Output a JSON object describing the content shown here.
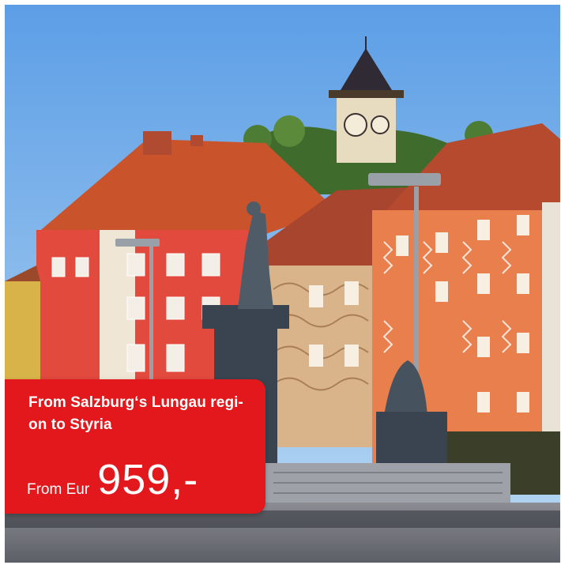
{
  "promo": {
    "title": "From Salzburg‘s Lungau regi-on to Styria",
    "price_prefix": "From Eur",
    "price_value": "959,-"
  },
  "colors": {
    "accent": "#e3181c",
    "text_on_accent": "#ffffff"
  },
  "image": {
    "icons": [
      "clock-tower-icon",
      "statue-icon",
      "street-lamp-icon"
    ]
  }
}
